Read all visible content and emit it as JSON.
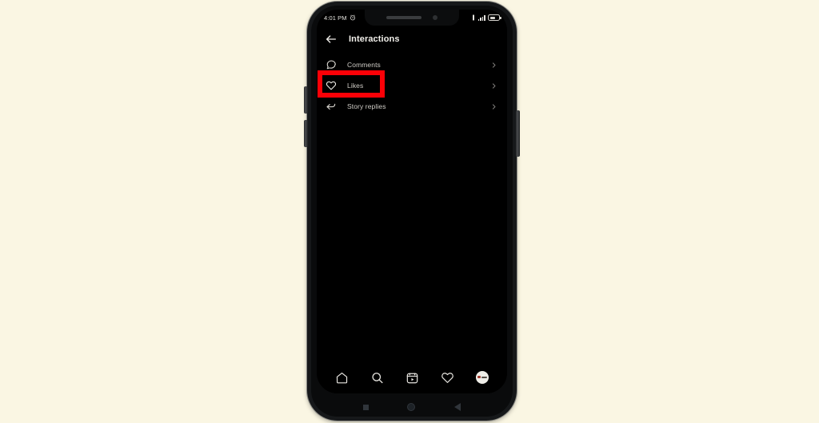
{
  "canvas": {
    "background_color": "#faf6e3"
  },
  "device": {
    "frame_color": "#16181a",
    "buttons": {
      "volume_up": "volume-up-button",
      "volume_down": "volume-down-button",
      "power": "power-button"
    }
  },
  "status_bar": {
    "time": "4:01 PM",
    "alarm_icon": "alarm-clock-icon",
    "signal_icon": "cellular-signal-icon",
    "vibrate_icon": "vibrate-icon",
    "battery_icon": "battery-icon"
  },
  "header": {
    "back_icon": "back-arrow-icon",
    "title": "Interactions"
  },
  "list": {
    "items": [
      {
        "label": "Comments",
        "icon": "comment-bubble-icon",
        "chevron": "chevron-right-icon"
      },
      {
        "label": "Likes",
        "icon": "heart-icon",
        "chevron": "chevron-right-icon"
      },
      {
        "label": "Story replies",
        "icon": "reply-arrow-icon",
        "chevron": "chevron-right-icon"
      }
    ]
  },
  "annotation": {
    "highlight_color": "#fb0007",
    "target": "Likes"
  },
  "bottom_nav": {
    "items": [
      {
        "name": "home-icon",
        "label": "Home"
      },
      {
        "name": "search-icon",
        "label": "Search"
      },
      {
        "name": "reels-icon",
        "label": "Reels"
      },
      {
        "name": "heart-icon",
        "label": "Activity"
      },
      {
        "name": "profile-avatar",
        "label": "Profile"
      }
    ]
  },
  "system_nav": {
    "recents": "recents-square-icon",
    "home": "home-circle-icon",
    "back": "back-triangle-icon"
  }
}
